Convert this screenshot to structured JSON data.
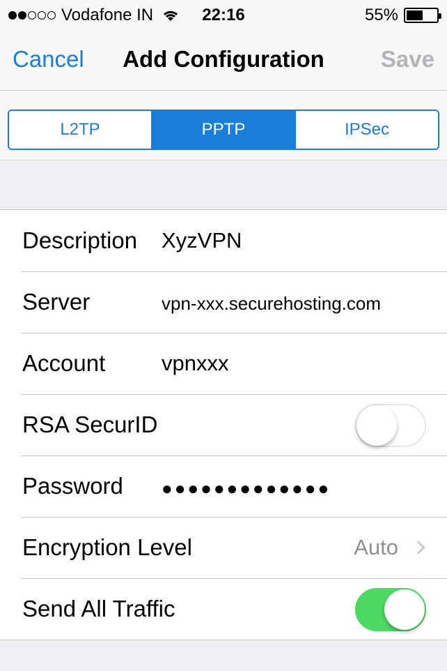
{
  "status_bar": {
    "signal_strength": 2,
    "signal_total": 5,
    "carrier": "Vodafone IN",
    "time": "22:16",
    "battery_percent": "55%",
    "battery_level": 0.55
  },
  "nav": {
    "cancel_label": "Cancel",
    "title": "Add Configuration",
    "save_label": "Save"
  },
  "segments": {
    "items": [
      {
        "label": "L2TP",
        "selected": false
      },
      {
        "label": "PPTP",
        "selected": true
      },
      {
        "label": "IPSec",
        "selected": false
      }
    ]
  },
  "form": {
    "description": {
      "label": "Description",
      "value": "XyzVPN"
    },
    "server": {
      "label": "Server",
      "value": "vpn-xxx.securehosting.com"
    },
    "account": {
      "label": "Account",
      "value": "vpnxxx"
    },
    "rsa": {
      "label": "RSA SecurID",
      "on": false
    },
    "password": {
      "label": "Password",
      "value": "●●●●●●●●●●●●●"
    },
    "encryption": {
      "label": "Encryption Level",
      "value": "Auto"
    },
    "send_all": {
      "label": "Send All Traffic",
      "on": true
    }
  },
  "colors": {
    "accent": "#1a7dd8",
    "toggle_on": "#4cd964",
    "disabled": "#b4b4b8"
  }
}
